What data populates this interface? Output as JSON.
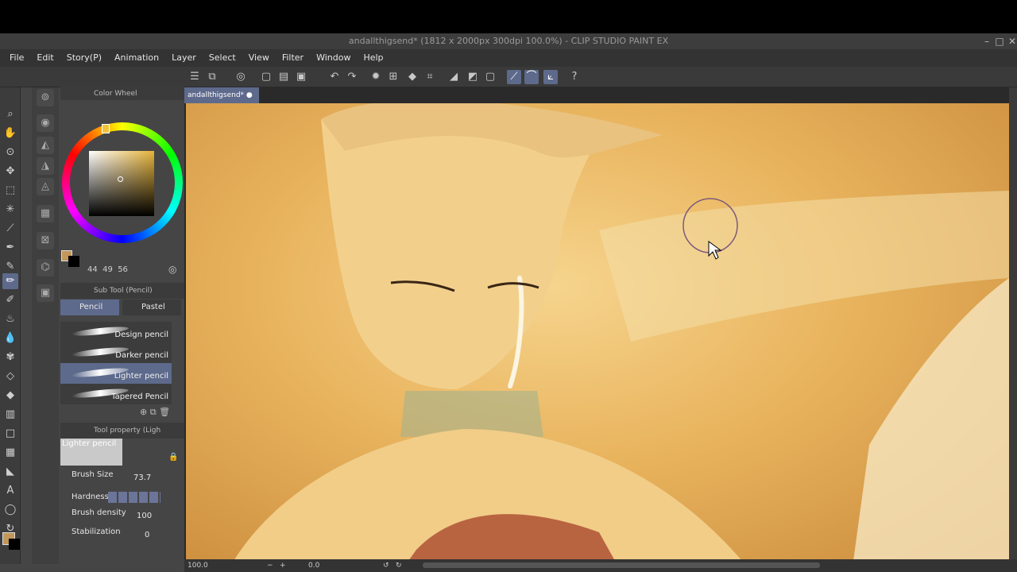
{
  "window": {
    "title": "andallthigsend* (1812 x 2000px 300dpi 100.0%) - CLIP STUDIO PAINT EX"
  },
  "menu": [
    "File",
    "Edit",
    "Story(P)",
    "Animation",
    "Layer",
    "Select",
    "View",
    "Filter",
    "Window",
    "Help"
  ],
  "doc_tab": {
    "label": "andallthigsend*"
  },
  "color_wheel": {
    "title": "Color Wheel",
    "h": "44",
    "s": "49",
    "v": "56",
    "main_color": "#c2975a",
    "sub_color": "#000000"
  },
  "sub_tool": {
    "title": "Sub Tool (Pencil)",
    "tabs": [
      "Pencil",
      "Pastel"
    ],
    "brushes": [
      "Design pencil",
      "Darker pencil",
      "Lighter pencil",
      "Tapered Pencil"
    ],
    "selected_brush": "Lighter pencil"
  },
  "tool_property": {
    "title": "Tool property (Ligh",
    "preview_label": "Lighter pencil",
    "brush_size_label": "Brush Size",
    "brush_size_value": "73.7",
    "hardness_label": "Hardness",
    "brush_density_label": "Brush density",
    "brush_density_value": "100",
    "stabilization_label": "Stabilization",
    "stabilization_value": "0"
  },
  "status": {
    "zoom": "100.0",
    "rotation": "0.0"
  },
  "colors": {
    "accent": "#5d6a8c",
    "panel": "#454545"
  }
}
